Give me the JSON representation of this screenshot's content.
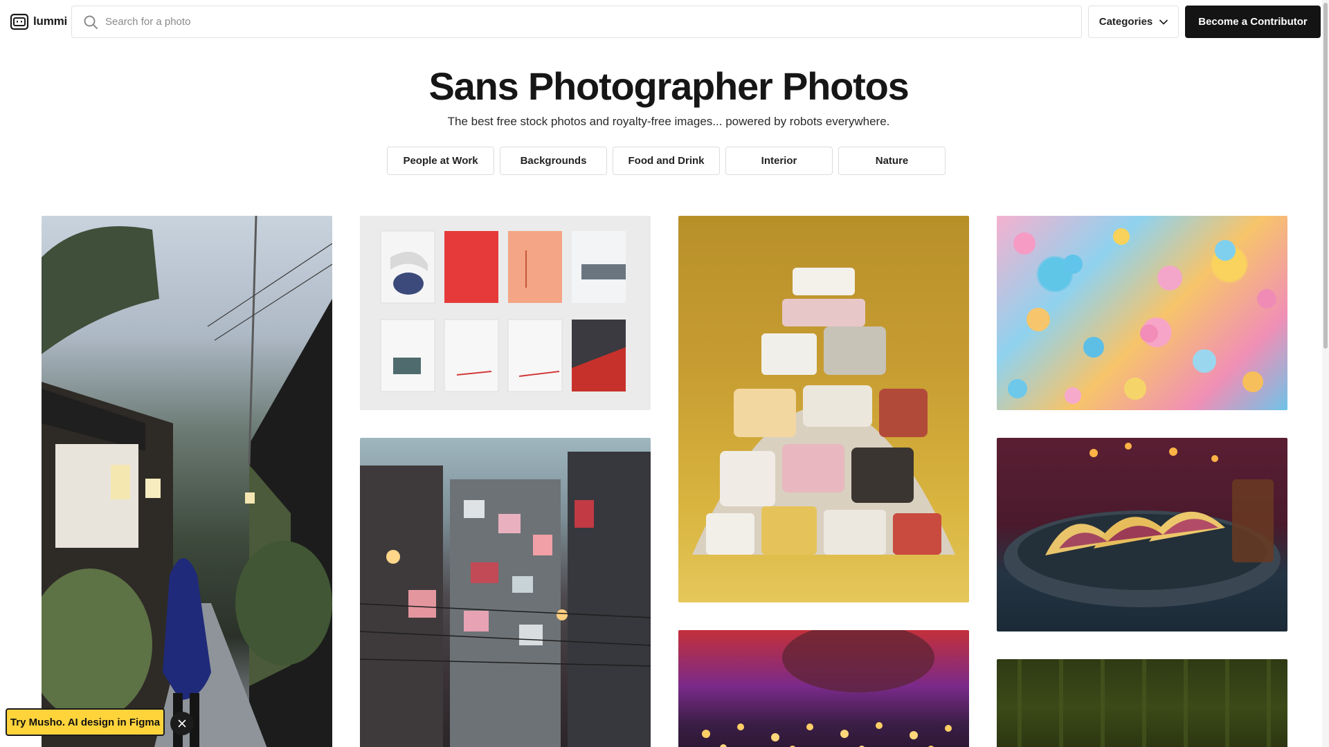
{
  "header": {
    "logo_text": "lummi",
    "search_placeholder": "Search for a photo",
    "categories_label": "Categories",
    "contributor_label": "Become a Contributor"
  },
  "hero": {
    "title": "Sans Photographer Photos",
    "subtitle": "The best free stock photos and royalty-free images... powered by robots everywhere.",
    "chips": [
      "People at Work",
      "Backgrounds",
      "Food and Drink",
      "Interior",
      "Nature"
    ]
  },
  "gallery": {
    "photos": [
      {
        "subject": "rainy-japanese-alley"
      },
      {
        "subject": "book-covers"
      },
      {
        "subject": "pill-bottle-pile"
      },
      {
        "subject": "pastel-confetti"
      },
      {
        "subject": "cluttered-city-buildings"
      },
      {
        "subject": "tacos-on-plate"
      },
      {
        "subject": "candles"
      },
      {
        "subject": "green-curtain"
      }
    ]
  },
  "promo": {
    "label": "Try Musho. AI design in Figma"
  },
  "icons": {
    "logo": "robot-face-icon",
    "search": "search-icon",
    "categories": "chevron-down-icon",
    "promo_close": "close-icon"
  },
  "colors": {
    "contributor_bg": "#141414",
    "promo_bg": "#ffd43b",
    "text": "#161616"
  }
}
